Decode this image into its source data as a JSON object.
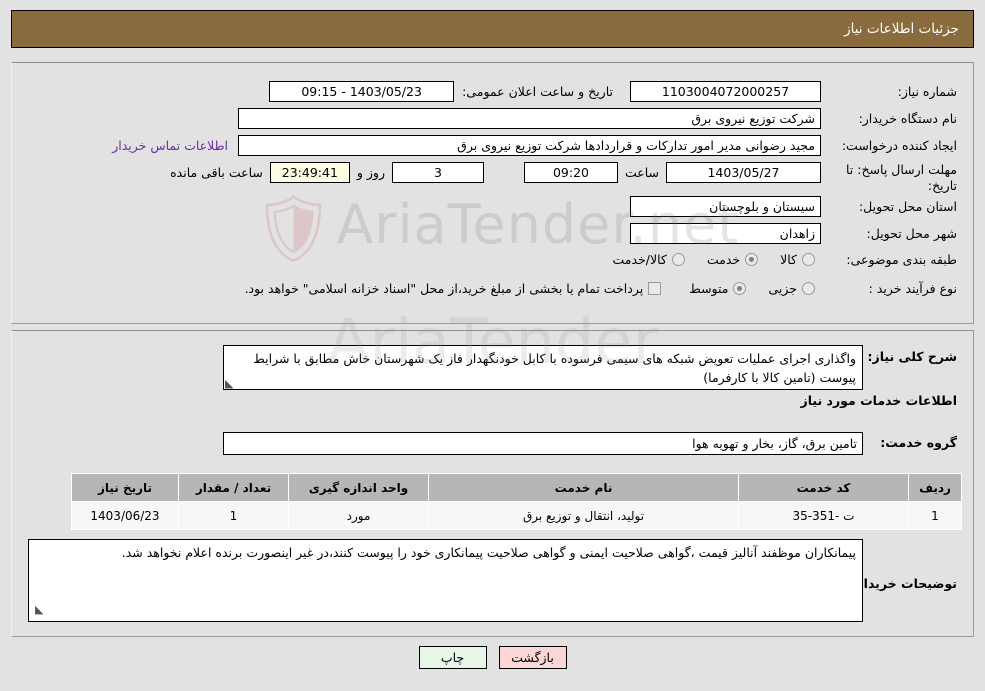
{
  "header": {
    "title": "جزئیات اطلاعات نیاز"
  },
  "fields": {
    "need_number_label": "شماره نیاز:",
    "need_number_value": "1103004072000257",
    "announce_label": "تاریخ و ساعت اعلان عمومی:",
    "announce_value": "1403/05/23 - 09:15",
    "buyer_org_label": "نام دستگاه خریدار:",
    "buyer_org_value": "شرکت توزیع نیروی برق",
    "creator_label": "ایجاد کننده درخواست:",
    "creator_value": "مجید  رضوانی مدیر امور تدارکات و قراردادها شرکت توزیع نیروی برق",
    "contact_link": "اطلاعات تماس خریدار",
    "deadline_label": "مهلت ارسال پاسخ: تا تاریخ:",
    "deadline_date": "1403/05/27",
    "hour_label": "ساعت",
    "deadline_time": "09:20",
    "days_value": "3",
    "days_label": "روز و",
    "countdown_value": "23:49:41",
    "remaining_label": "ساعت باقی مانده",
    "province_label": "استان محل تحویل:",
    "province_value": "سیستان و بلوچستان",
    "city_label": "شهر محل تحویل:",
    "city_value": "زاهدان",
    "category_label": "طبقه بندی موضوعی:",
    "purchase_type_label": "نوع فرآیند خرید :",
    "treasury_note": "پرداخت تمام یا بخشی از مبلغ خرید،از محل \"اسناد خزانه اسلامی\" خواهد بود."
  },
  "category_options": [
    {
      "label": "کالا",
      "selected": false
    },
    {
      "label": "خدمت",
      "selected": true
    },
    {
      "label": "کالا/خدمت",
      "selected": false
    }
  ],
  "purchase_options": [
    {
      "label": "جزیی",
      "selected": false
    },
    {
      "label": "متوسط",
      "selected": true
    }
  ],
  "description": {
    "label": "شرح کلی نیاز:",
    "value": "واگذاری اجرای عملیات تعویض شبکه های سیمی فرسوده با کابل خودنگهدار فاز یک شهرستان خاش مطابق با شرایط پیوست (تامین کالا با کارفرما)"
  },
  "services_section": {
    "heading": "اطلاعات خدمات مورد نیاز",
    "group_label": "گروه خدمت:",
    "group_value": "تامین برق، گاز، بخار و تهویه هوا"
  },
  "table": {
    "headers": [
      "ردیف",
      "کد خدمت",
      "نام خدمت",
      "واحد اندازه گیری",
      "تعداد / مقدار",
      "تاریخ نیاز"
    ],
    "rows": [
      [
        "1",
        "ت -351-35",
        "تولید، انتقال و توزیع برق",
        "مورد",
        "1",
        "1403/06/23"
      ]
    ]
  },
  "buyer_notes": {
    "label": "توضیحات خریدار:",
    "value": "پیمانکاران موظفند آنالیز قیمت ،گواهی صلاحیت ایمنی و گواهی صلاحیت پیمانکاری خود را پیوست کنند،در غیر اینصورت برنده اعلام نخواهد شد."
  },
  "buttons": {
    "print": "چاپ",
    "back": "بازگشت"
  },
  "watermark": {
    "line1": "AriaTender.net",
    "line2": "AriaTender"
  },
  "colors": {
    "header_bg": "#8a6b3d",
    "page_bg": "#e2e2e2",
    "link": "#6a2fa0",
    "print_btn": "#e8f6e8",
    "back_btn": "#fbd6d6",
    "countdown_bg": "#fdfde4",
    "table_header_bg": "#b6b6b6"
  }
}
